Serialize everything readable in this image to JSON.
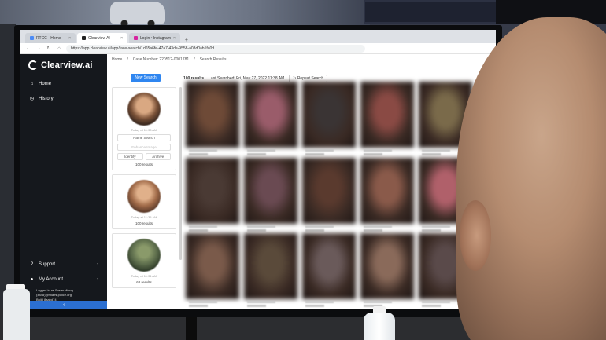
{
  "browser": {
    "tabs": [
      {
        "label": "RTCC - Home",
        "active": false
      },
      {
        "label": "Clearview AI",
        "active": true
      },
      {
        "label": "Login • Instagram",
        "active": false
      }
    ],
    "new_tab": "+",
    "url": "https://app.clearview.ai/app/face-search/1d65a6fe-47a7-43de-9558-a03d0ab1fa0d"
  },
  "sidebar": {
    "brand": "Clearview.ai",
    "items": [
      {
        "label": "Home",
        "icon": "home-icon"
      },
      {
        "label": "History",
        "icon": "history-icon"
      }
    ],
    "bottom": [
      {
        "label": "Support",
        "icon": "help-icon"
      },
      {
        "label": "My Account",
        "icon": "user-icon"
      }
    ],
    "login_line1": "Logged in as Susan Wong",
    "login_line2": "(4848)@miami-police.org",
    "build": "Build 8aabd74",
    "collapse_label": "‹"
  },
  "breadcrumb": {
    "home": "Home",
    "case": "Case Number: 220512-0001781",
    "current": "Search Results"
  },
  "toolbar": {
    "new_search_label": "New Search",
    "results_count": "100 results",
    "last_searched": "Last Searched: Fri, May 27, 2022 11:38 AM",
    "repeat_search_label": "Repeat Search"
  },
  "history": [
    {
      "time": "Today at 11:38 AM",
      "name_search": "Name Search",
      "enhance": "Enhance Image",
      "identify": "Identify",
      "archive": "Archive",
      "results": "100 results"
    },
    {
      "time": "Today at 11:35 AM",
      "results": "100 results"
    },
    {
      "time": "Today at 11:34 AM",
      "results": "68 results"
    }
  ],
  "results_colors": [
    "#6e4a37",
    "#9a5c6a",
    "#3a3434",
    "#8a4a44",
    "#7a6a4a",
    "#4a3a34",
    "#6a4a52",
    "#5a3a2e",
    "#8a5a4a",
    "#b0606a",
    "#7a5a4a",
    "#5a4a3a",
    "#6a5a5a",
    "#8a6a5a",
    "#5a4a4a"
  ]
}
